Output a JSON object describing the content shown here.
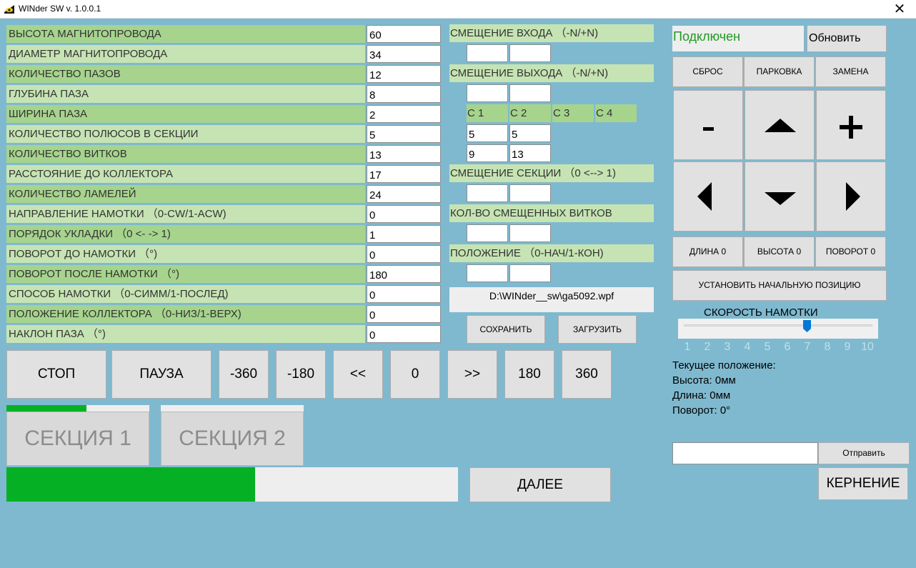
{
  "window": {
    "title": "WINder SW v. 1.0.0.1",
    "close_glyph": "✕"
  },
  "params": [
    {
      "label": "ВЫСОТА МАГНИТОПРОВОДА",
      "value": "60"
    },
    {
      "label": "ДИАМЕТР МАГНИТОПРОВОДА",
      "value": "34"
    },
    {
      "label": "КОЛИЧЕСТВО ПАЗОВ",
      "value": "12"
    },
    {
      "label": "ГЛУБИНА ПАЗА",
      "value": "8"
    },
    {
      "label": "ШИРИНА ПАЗА",
      "value": "2"
    },
    {
      "label": "КОЛИЧЕСТВО ПОЛЮСОВ В СЕКЦИИ",
      "value": "5"
    },
    {
      "label": "КОЛИЧЕСТВО ВИТКОВ",
      "value": "13"
    },
    {
      "label": "РАССТОЯНИЕ ДО КОЛЛЕКТОРА",
      "value": "17"
    },
    {
      "label": "КОЛИЧЕСТВО ЛАМЕЛЕЙ",
      "value": "24"
    },
    {
      "label": "НАПРАВЛЕНИЕ НАМОТКИ （0-CW/1-ACW)",
      "value": "0"
    },
    {
      "label": "ПОРЯДОК УКЛАДКИ （0 <- -> 1)",
      "value": "1"
    },
    {
      "label": "ПОВОРОТ ДО НАМОТКИ （°)",
      "value": "0"
    },
    {
      "label": "ПОВОРОТ ПОСЛЕ НАМОТКИ （°)",
      "value": "180"
    },
    {
      "label": "СПОСОБ НАМОТКИ （0-СИММ/1-ПОСЛЕД)",
      "value": "0"
    },
    {
      "label": "ПОЛОЖЕНИЕ КОЛЛЕКТОРА （0-НИЗ/1-ВЕРХ)",
      "value": "0"
    },
    {
      "label": "НАКЛОН ПАЗА （°)",
      "value": "0"
    }
  ],
  "offsets": {
    "input_offset_label": "СМЕЩЕНИЕ ВХОДА （-N/+N)",
    "input_offset_values": [
      "",
      ""
    ],
    "output_offset_label": "СМЕЩЕНИЕ ВЫХОДА （-N/+N)",
    "output_offset_values": [
      "",
      ""
    ],
    "c_tabs": [
      "С 1",
      "С 2",
      "С 3",
      "С 4"
    ],
    "c_values_row1": [
      "5",
      "5"
    ],
    "c_values_row2": [
      "9",
      "13"
    ],
    "section_offset_label": "СМЕЩЕНИЕ СЕКЦИИ （0 <--> 1)",
    "section_offset_values": [
      "",
      ""
    ],
    "shifted_turns_label": "КОЛ-ВО СМЕЩЕННЫХ ВИТКОВ",
    "shifted_turns_values": [
      "",
      ""
    ],
    "position_label": "ПОЛОЖЕНИЕ （0-НАЧ/1-КОН)",
    "position_values": [
      "",
      ""
    ]
  },
  "file": {
    "path": "D:\\WINder__sw\\ga5092.wpf",
    "save_label": "СОХРАНИТЬ",
    "load_label": "ЗАГРУЗИТЬ"
  },
  "connection": {
    "status": "Подключен",
    "status_color": "#1f9a1f",
    "refresh_label": "Обновить"
  },
  "control": {
    "reset_label": "СБРОС",
    "park_label": "ПАРКОВКА",
    "replace_label": "ЗАМЕНА",
    "minus_glyph": "-",
    "plus_glyph": "+",
    "length0_label": "ДЛИНА 0",
    "height0_label": "ВЫСОТА 0",
    "rotate0_label": "ПОВОРОТ 0",
    "set_start_label": "УСТАНОВИТЬ НАЧАЛЬНУЮ ПОЗИЦИЮ"
  },
  "speed": {
    "title": "СКОРОСТЬ НАМОТКИ",
    "value": 7,
    "ticks": [
      "1",
      "2",
      "3",
      "4",
      "5",
      "6",
      "7",
      "8",
      "9",
      "10"
    ],
    "thumb_color": "#0078d7"
  },
  "position": {
    "heading": "Текущее положение:",
    "height": "Высота: 0мм",
    "length": "Длина: 0мм",
    "rotation": "Поворот: 0°"
  },
  "motion_buttons": [
    "СТОП",
    "ПАУЗА",
    "-360",
    "-180",
    "<<",
    "0",
    ">>",
    "180",
    "360"
  ],
  "sections": {
    "section1_label": "СЕКЦИЯ 1",
    "section1_progress": 0.56,
    "section2_label": "СЕКЦИЯ 2",
    "section2_progress": 0.0
  },
  "main_progress": 0.55,
  "progress_color": "#06b025",
  "next_label": "ДАЛЕЕ",
  "send": {
    "value": "",
    "button_label": "Отправить"
  },
  "punch_label": "КЕРНЕНИЕ"
}
